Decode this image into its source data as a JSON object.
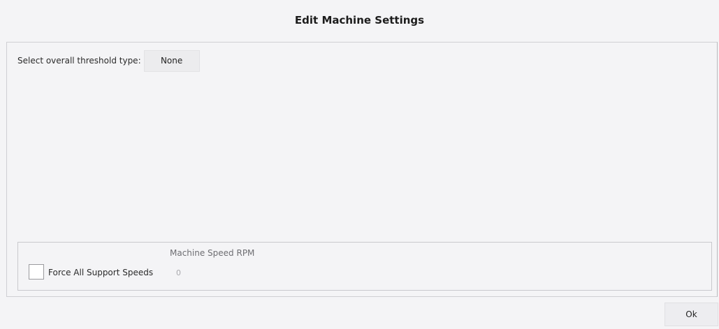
{
  "dialog": {
    "title": "Edit Machine Settings"
  },
  "threshold": {
    "label": "Select overall threshold type:",
    "selected": "None"
  },
  "support_speeds": {
    "column_header": "Machine Speed RPM",
    "force_checkbox_label": "Force All Support Speeds",
    "force_checked": false,
    "speed_value": "0"
  },
  "footer": {
    "ok_label": "Ok"
  }
}
